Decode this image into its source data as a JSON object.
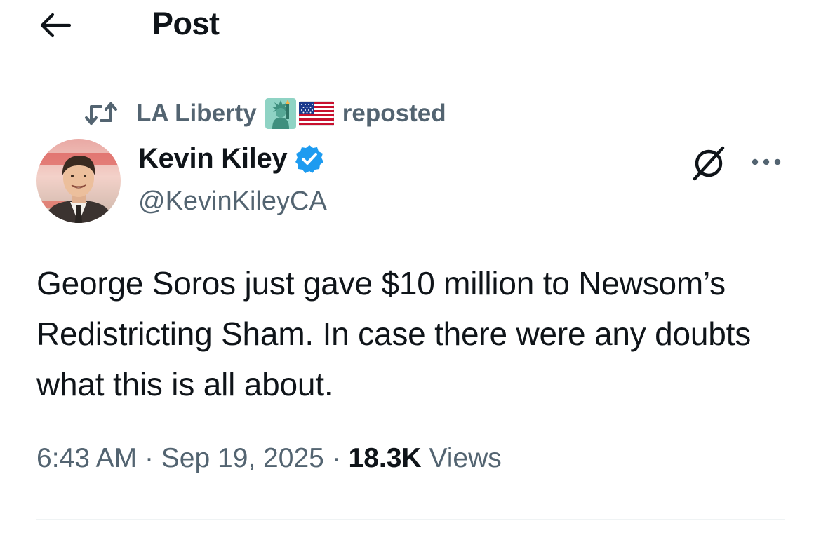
{
  "header": {
    "title": "Post"
  },
  "repost": {
    "reposter_name": "LA Liberty",
    "suffix": "reposted",
    "emojis": [
      "statue-of-liberty-emoji",
      "us-flag-emoji"
    ]
  },
  "author": {
    "name": "Kevin Kiley",
    "handle": "@KevinKileyCA",
    "verified": true
  },
  "tweet": {
    "text": "George Soros just gave $10 million to Newsom’s Redistricting Sham. In case there were any doubts what this is all about."
  },
  "meta": {
    "time": "6:43 AM",
    "separator": "·",
    "date": "Sep 19, 2025",
    "views_count": "18.3K",
    "views_label": "Views"
  },
  "colors": {
    "text_primary": "#0f1419",
    "text_secondary": "#536471",
    "verified_blue": "#1d9bf0",
    "divider": "#eff3f4"
  },
  "icons": {
    "back": "arrow-left-icon",
    "repost": "repost-icon",
    "verified": "verified-badge-icon",
    "grok": "grok-icon",
    "more": "more-horizontal-icon"
  }
}
